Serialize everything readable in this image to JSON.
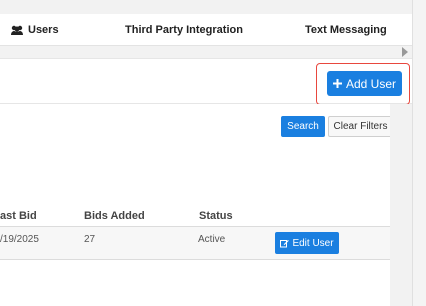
{
  "tabs": {
    "users": "Users",
    "third_party": "Third Party Integration",
    "text_messaging": "Text Messaging"
  },
  "header": {
    "add_user_label": "Add User"
  },
  "filters": {
    "search_label": "Search",
    "clear_label": "Clear Filters"
  },
  "table": {
    "columns": [
      "ast Bid",
      "Bids Added",
      "Status"
    ],
    "rows": [
      {
        "last_bid": "/19/2025",
        "bids_added": "27",
        "status": "Active",
        "action": "Edit User"
      }
    ]
  },
  "colors": {
    "primary": "#1a7fe0",
    "highlight": "#e8473e"
  }
}
